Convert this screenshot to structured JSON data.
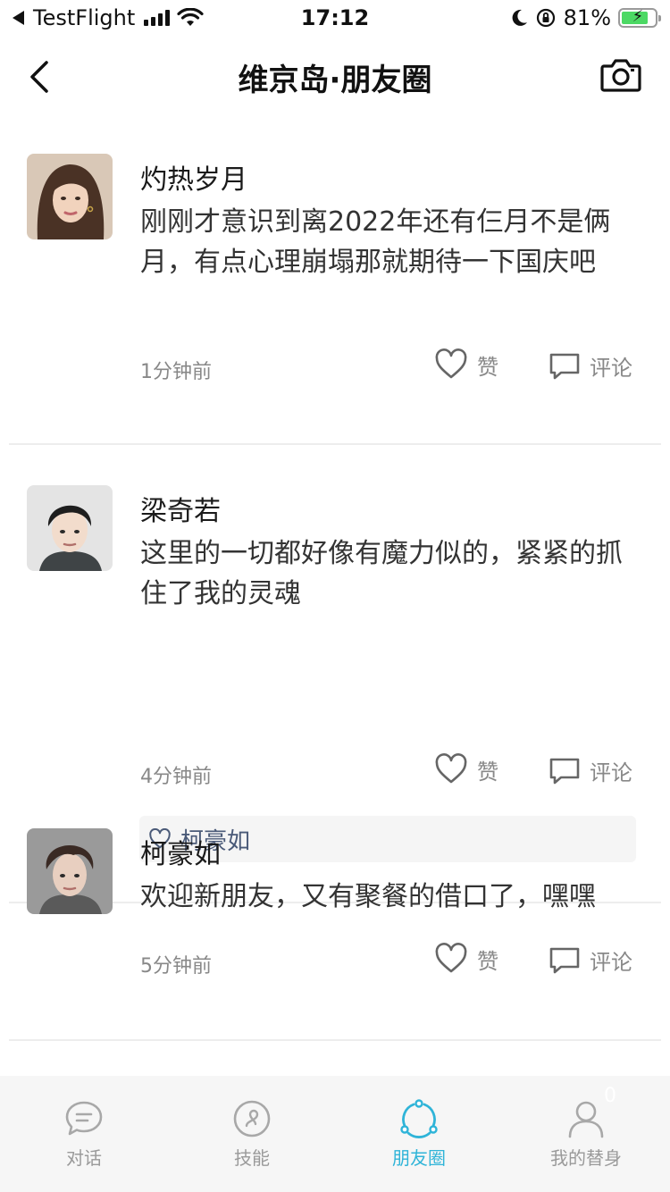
{
  "status_bar": {
    "carrier": "TestFlight",
    "time": "17:12",
    "battery_percent": "81%",
    "battery_level": 0.81
  },
  "nav": {
    "title": "维京岛·朋友圈"
  },
  "posts": [
    {
      "name": "灼热岁月",
      "content": "刚刚才意识到离2022年还有仨月不是俩月，有点心理崩塌那就期待一下国庆吧",
      "time": "1分钟前",
      "like_label": "赞",
      "comment_label": "评论",
      "likes": ""
    },
    {
      "name": "梁奇若",
      "content": "这里的一切都好像有魔力似的，紧紧的抓住了我的灵魂",
      "time": "4分钟前",
      "like_label": "赞",
      "comment_label": "评论",
      "likes": "柯豪如"
    },
    {
      "name": "柯豪如",
      "content": "欢迎新朋友，又有聚餐的借口了，嘿嘿",
      "time": "5分钟前",
      "like_label": "赞",
      "comment_label": "评论",
      "likes": ""
    }
  ],
  "tabs": [
    {
      "label": "对话",
      "icon": "chat-bubble-icon",
      "active": false
    },
    {
      "label": "技能",
      "icon": "skill-icon",
      "active": false
    },
    {
      "label": "朋友圈",
      "icon": "moments-icon",
      "active": true
    },
    {
      "label": "我的替身",
      "icon": "profile-icon",
      "active": false
    }
  ],
  "tab_badge": "0",
  "colors": {
    "accent": "#2fb4d8",
    "inactive": "#9a9a9a",
    "like_names": "#4a5a78",
    "battery": "#4cd964"
  }
}
